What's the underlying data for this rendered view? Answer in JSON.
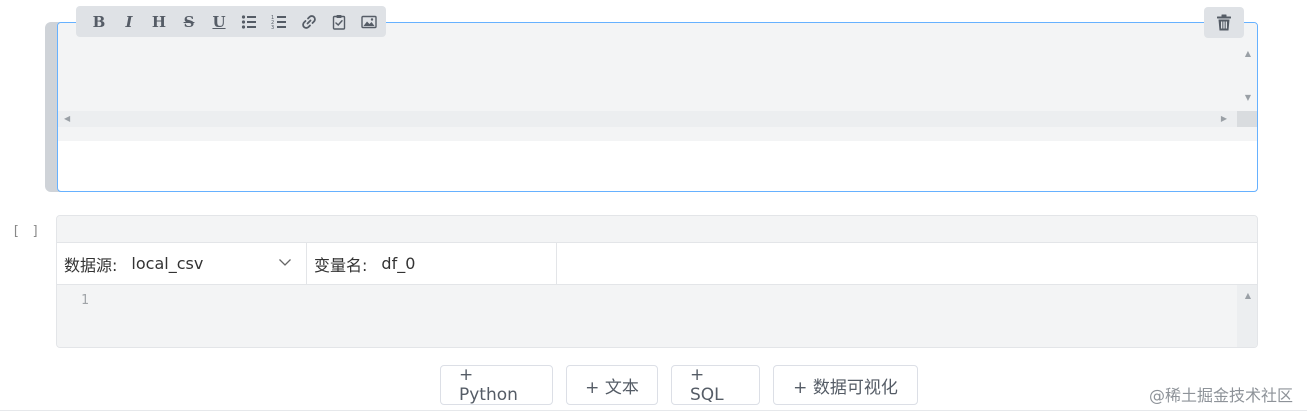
{
  "markdown_cell": {
    "toolbar": [
      {
        "name": "bold-button",
        "icon": "bold-icon",
        "glyph": "B"
      },
      {
        "name": "italic-button",
        "icon": "italic-icon",
        "glyph": "I"
      },
      {
        "name": "heading-button",
        "icon": "heading-icon",
        "glyph": "H"
      },
      {
        "name": "strikethrough-button",
        "icon": "strikethrough-icon",
        "glyph": "S"
      },
      {
        "name": "underline-button",
        "icon": "underline-icon",
        "glyph": "U"
      },
      {
        "name": "bullet-list-button",
        "icon": "bullet-list-icon",
        "glyph": ""
      },
      {
        "name": "numbered-list-button",
        "icon": "numbered-list-icon",
        "glyph": ""
      },
      {
        "name": "link-button",
        "icon": "link-icon",
        "glyph": ""
      },
      {
        "name": "checklist-button",
        "icon": "clipboard-check-icon",
        "glyph": ""
      },
      {
        "name": "image-button",
        "icon": "image-icon",
        "glyph": ""
      }
    ],
    "delete_icon": "trash-icon"
  },
  "code_cell": {
    "exec_count": "[ ]",
    "source_label": "数据源:",
    "source_value": "local_csv",
    "var_label": "变量名:",
    "var_value": "df_0",
    "line_number": "1"
  },
  "add_buttons": {
    "python": "+ Python",
    "text": "+ 文本",
    "sql": "+ SQL",
    "viz": "+ 数据可视化"
  },
  "watermark": "@稀土掘金技术社区",
  "colors": {
    "focus_border": "#66b1ff",
    "toolbar_bg": "#dfe2e6",
    "editor_bg": "#f3f4f5"
  }
}
